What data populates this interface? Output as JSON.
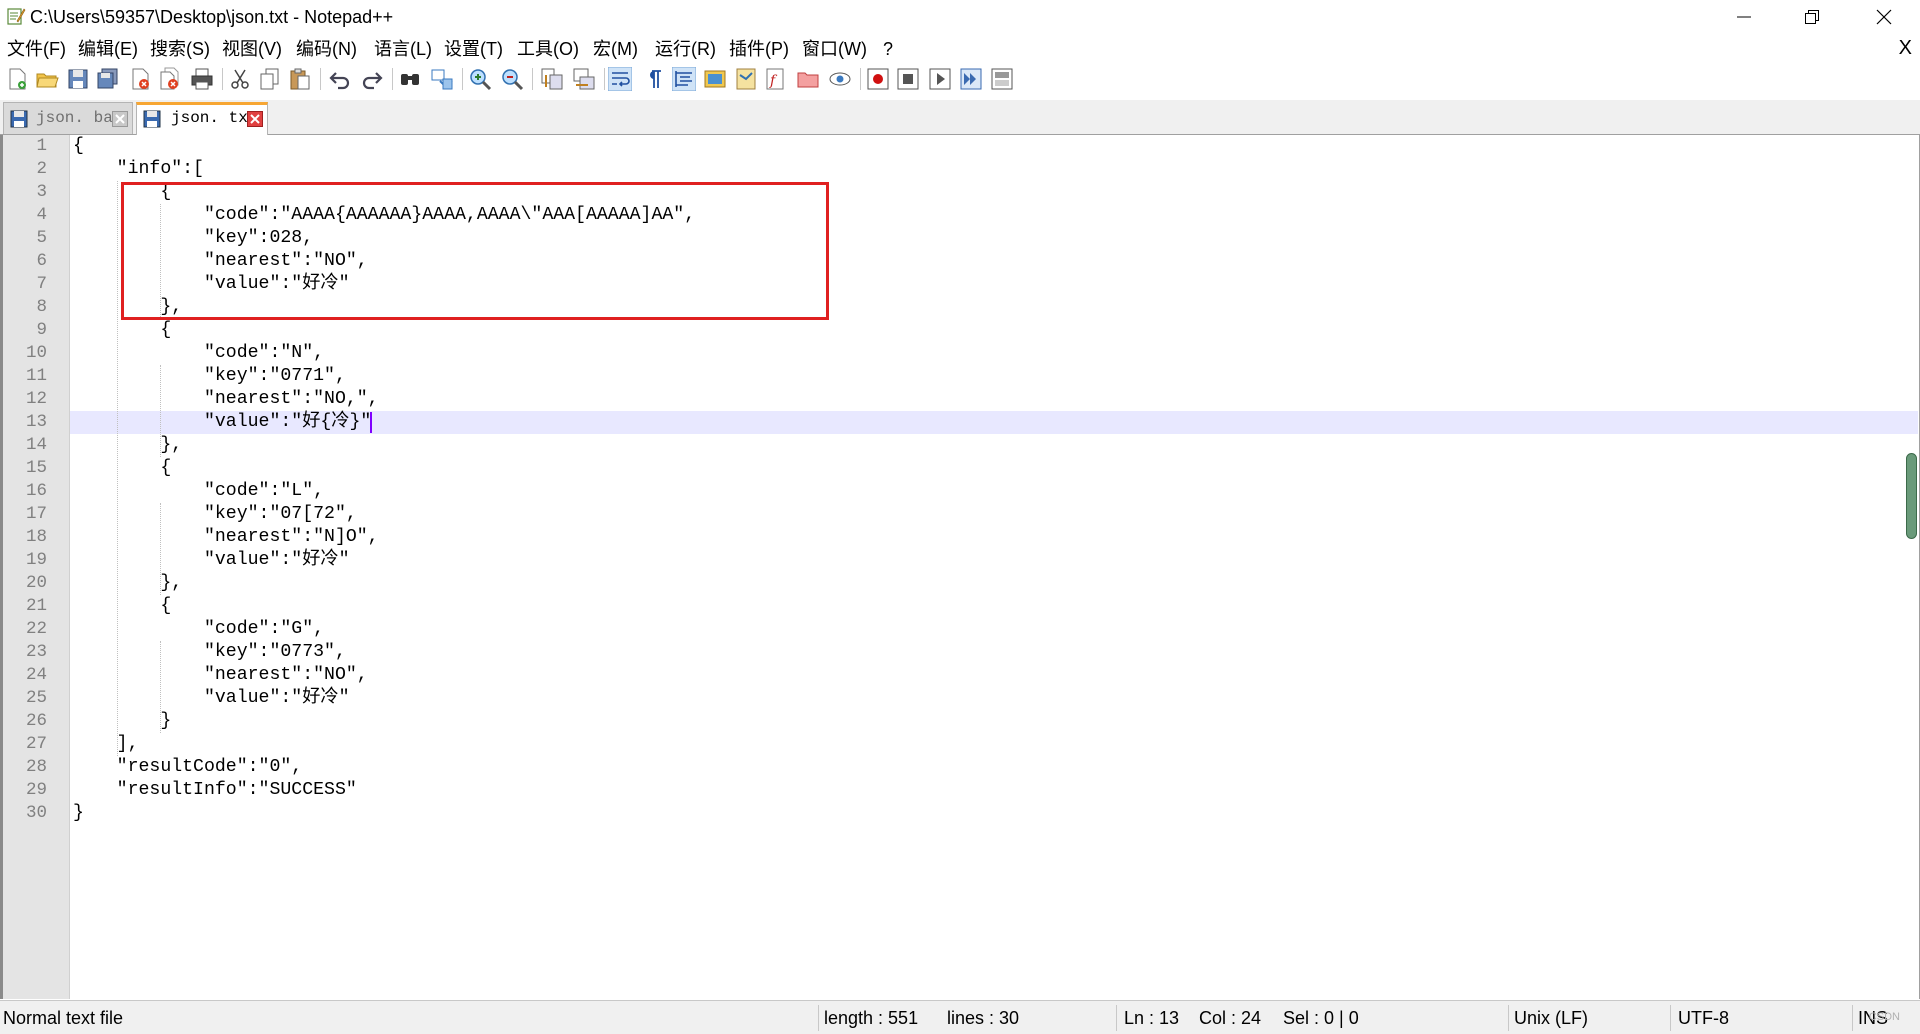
{
  "window": {
    "title": "C:\\Users\\59357\\Desktop\\json.txt - Notepad++",
    "buttons": {
      "minimize": "minimize-icon",
      "restore": "restore-icon",
      "close": "close-icon"
    }
  },
  "menu": {
    "items": [
      "文件(F)",
      "编辑(E)",
      "搜索(S)",
      "视图(V)",
      "编码(N)",
      "语言(L)",
      "设置(T)",
      "工具(O)",
      "宏(M)",
      "运行(R)",
      "插件(P)",
      "窗口(W)",
      "?"
    ],
    "close_doc": "X"
  },
  "toolbar": {
    "icons": [
      "new-file-icon",
      "open-file-icon",
      "save-icon",
      "save-all-icon",
      "close-icon",
      "close-all-icon",
      "print-icon",
      "cut-icon",
      "copy-icon",
      "paste-icon",
      "undo-icon",
      "redo-icon",
      "find-icon",
      "replace-icon",
      "zoom-in-icon",
      "zoom-out-icon",
      "sync-vertical-icon",
      "sync-horizontal-icon",
      "word-wrap-icon",
      "show-all-chars-icon",
      "indent-guide-icon",
      "define-language-icon",
      "doc-map-icon",
      "function-list-icon",
      "folder-workspace-icon",
      "monitor-icon",
      "record-macro-icon",
      "stop-macro-icon",
      "play-macro-icon",
      "run-macro-multiple-icon",
      "save-macro-icon"
    ]
  },
  "tabs": [
    {
      "label": "json. bat",
      "active": false
    },
    {
      "label": "json. txt",
      "active": true
    }
  ],
  "editor": {
    "lines": [
      "{",
      "    \"info\":[",
      "        {",
      "            \"code\":\"AAAA{AAAAAA}AAAA,AAAA\\\"AAA[AAAAA]AA\",",
      "            \"key\":028,",
      "            \"nearest\":\"NO\",",
      "            \"value\":\"好冷\"",
      "        },",
      "        {",
      "            \"code\":\"N\",",
      "            \"key\":\"0771\",",
      "            \"nearest\":\"NO,\",",
      "            \"value\":\"好{冷}\"",
      "        },",
      "        {",
      "            \"code\":\"L\",",
      "            \"key\":\"07[72\",",
      "            \"nearest\":\"N]O\",",
      "            \"value\":\"好冷\"",
      "        },",
      "        {",
      "            \"code\":\"G\",",
      "            \"key\":\"0773\",",
      "            \"nearest\":\"NO\",",
      "            \"value\":\"好冷\"",
      "        }",
      "    ],",
      "    \"resultCode\":\"0\",",
      "    \"resultInfo\":\"SUCCESS\"",
      "}"
    ],
    "current_line": 13,
    "highlighted_lines": [
      3,
      8
    ]
  },
  "status": {
    "file_type": "Normal text file",
    "length": "length : 551",
    "lines": "lines : 30",
    "ln": "Ln : 13",
    "col": "Col : 24",
    "sel": "Sel : 0 | 0",
    "eol": "Unix (LF)",
    "encoding": "UTF-8",
    "mode": "INS",
    "watermark": "CSDN"
  },
  "colors": {
    "highlight_box": "#e02020",
    "current_line_bg": "#e8e8ff",
    "caret": "#8000ff",
    "active_tab_accent": "#f7a633"
  }
}
